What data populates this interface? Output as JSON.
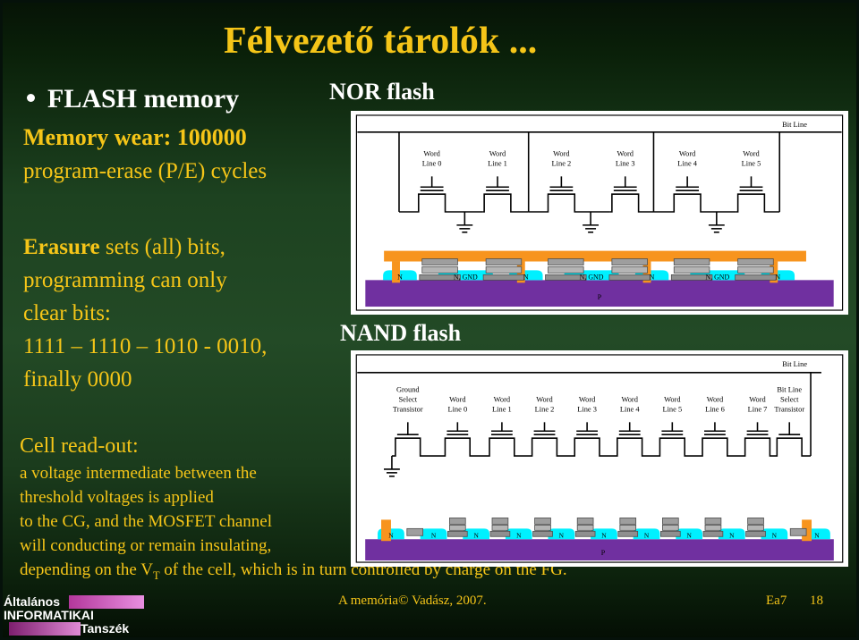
{
  "slide": {
    "title": "Félvezető tárolók ...",
    "bullet_label": "FLASH memory",
    "wear_line1": "Memory wear: 100000",
    "wear_line2": "program-erase (P/E) cycles"
  },
  "erasure": {
    "lead": "Erasure",
    "line1_rest": " sets (all) bits,",
    "line2": "programming can only",
    "line3": "clear bits:",
    "line4": "1111 – 1110 – 1010 - 0010,",
    "line5": "finally 0000"
  },
  "readout": {
    "title": "Cell read-out:",
    "line1": "a voltage intermediate between the",
    "line2": "threshold voltages is applied",
    "line3": "to the CG, and the MOSFET channel",
    "line4": "will conducting or remain insulating,",
    "line5_a": "depending on the V",
    "line5_sub": "T",
    "line5_b": " of the cell, which is in turn controlled by charge on the FG."
  },
  "headings": {
    "nor": "NOR flash",
    "nand": "NAND flash"
  },
  "nor_diagram": {
    "bit_line_label": "Bit Line",
    "word_lines": [
      "Word\nLine 0",
      "Word\nLine 1",
      "Word\nLine 2",
      "Word\nLine 3",
      "Word\nLine 4",
      "Word\nLine 5"
    ],
    "word_line_labels_top": [
      "Word",
      "Word",
      "Word",
      "Word",
      "Word",
      "Word"
    ],
    "word_line_labels_bottom": [
      "Line 0",
      "Line 1",
      "Line 2",
      "Line 3",
      "Line 4",
      "Line 5"
    ],
    "substrate_label": "P",
    "diffusion_labels": [
      "N",
      "N, GND",
      "N",
      "N, GND",
      "N",
      "N, GND",
      "N"
    ],
    "ground_symbol_count": 3
  },
  "nand_diagram": {
    "bit_line_label": "Bit Line",
    "left_transistor_label": [
      "Ground",
      "Select",
      "Transistor"
    ],
    "right_transistor_label": [
      "Bit Line",
      "Select",
      "Transistor"
    ],
    "word_line_labels_top": [
      "Word",
      "Word",
      "Word",
      "Word",
      "Word",
      "Word",
      "Word",
      "Word"
    ],
    "word_line_labels_bottom": [
      "Line 0",
      "Line 1",
      "Line 2",
      "Line 3",
      "Line 4",
      "Line 5",
      "Line 6",
      "Line 7"
    ],
    "substrate_label": "P",
    "diffusion_labels": [
      "N",
      "N",
      "N",
      "N",
      "N",
      "N",
      "N",
      "N",
      "N",
      "N",
      "N"
    ],
    "ground_symbol_count": 1
  },
  "footer": {
    "center": "A memória© Vadász, 2007.",
    "lecture": "Ea7",
    "page": "18"
  },
  "logo": {
    "line1": "Általános",
    "line2": "INFORMATIKAI",
    "line3": "Tanszék"
  },
  "colors": {
    "background_green": "#1d4220",
    "title_gold": "#F5C518",
    "heading_white": "#ffffff",
    "metal_orange": "#F7941E",
    "gate_gray": "#9e9e9e",
    "diffusion_cyan": "#00F0FF",
    "substrate_purple": "#7030A0"
  }
}
